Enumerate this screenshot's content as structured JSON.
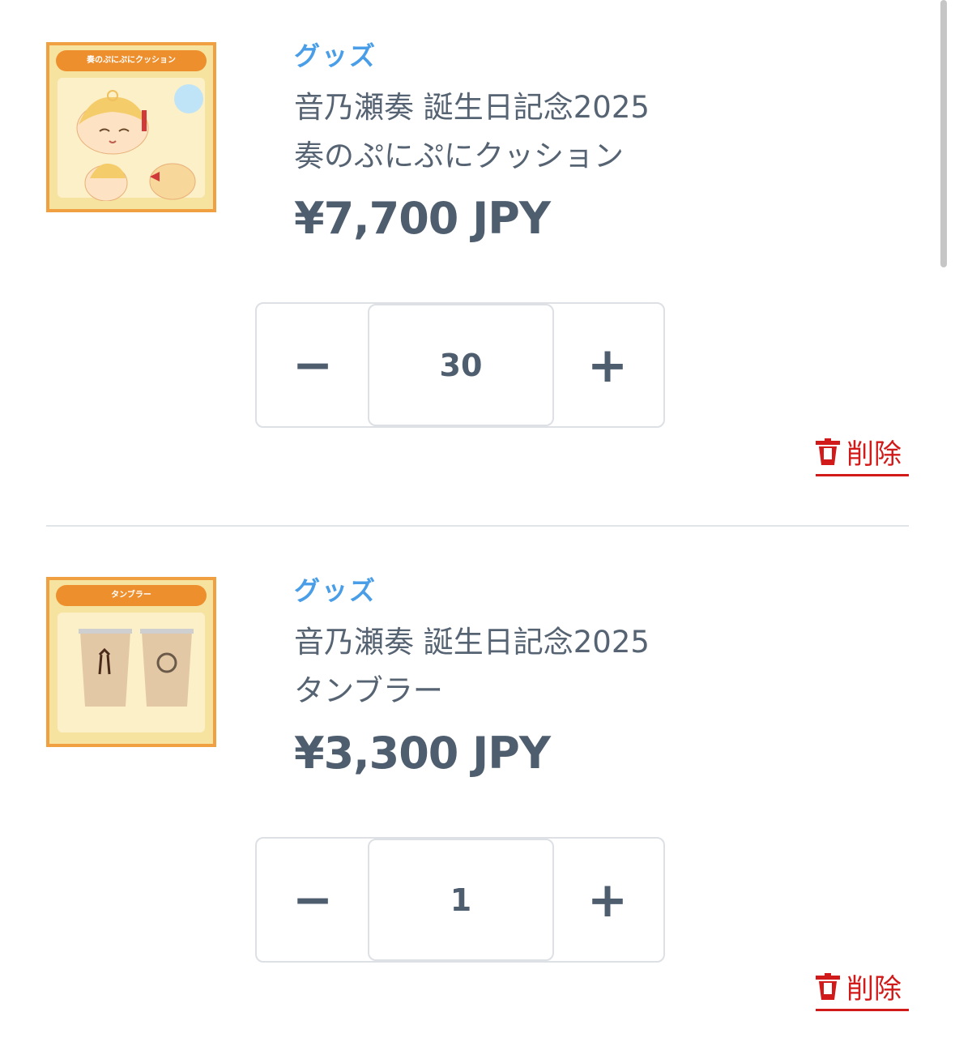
{
  "items": [
    {
      "thumb_banner": "奏のぷにぷにクッション",
      "category": "グッズ",
      "name_line1": "音乃瀬奏 誕生日記念2025",
      "name_line2": "奏のぷにぷにクッション",
      "price": "¥7,700 JPY",
      "quantity": "30",
      "minus_label": "−",
      "plus_label": "+",
      "delete_label": "削除"
    },
    {
      "thumb_banner": "タンブラー",
      "category": "グッズ",
      "name_line1": "音乃瀬奏 誕生日記念2025",
      "name_line2": "タンブラー",
      "price": "¥3,300 JPY",
      "quantity": "1",
      "minus_label": "−",
      "plus_label": "+",
      "delete_label": "削除"
    }
  ],
  "colors": {
    "accent": "#4a9ee8",
    "text": "#4f5e6f",
    "delete": "#d11a1a",
    "border": "#dde0e4"
  },
  "icons": {
    "delete": "trash-icon",
    "minus": "minus-icon",
    "plus": "plus-icon"
  }
}
